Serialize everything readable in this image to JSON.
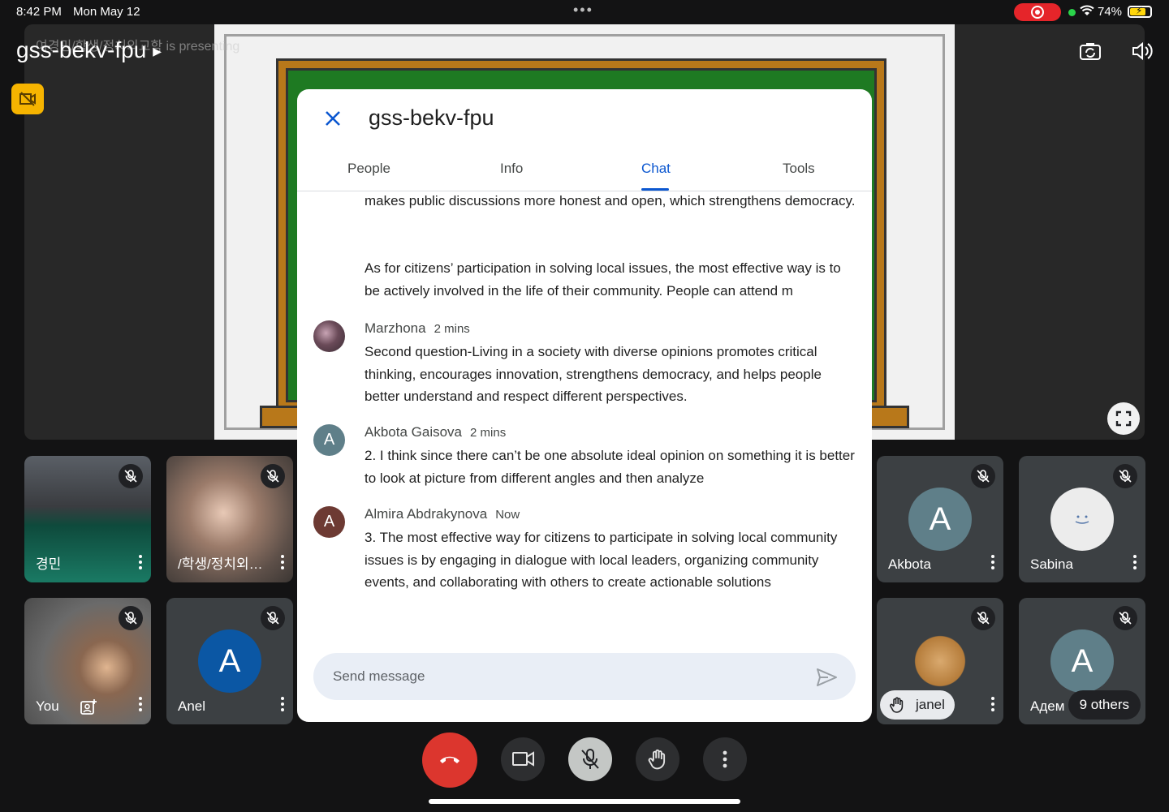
{
  "status_bar": {
    "time": "8:42 PM",
    "date": "Mon May 12",
    "battery": "74%",
    "battery_level": 0.74
  },
  "meeting": {
    "title": "gss-bekv-fpu",
    "presenting_text": "여경민/학생/정치외교학 is presenting"
  },
  "tiles": [
    {
      "name": "경민",
      "muted": true
    },
    {
      "name": "/학생/정치외…",
      "muted": true
    },
    {
      "name": "You",
      "muted": true
    },
    {
      "name": "Anel",
      "avatar_letter": "A",
      "avatar_color": "#0b57a4",
      "muted": true
    },
    {
      "name": "Akbota",
      "avatar_letter": "A",
      "avatar_color": "#5f7f89",
      "muted": true
    },
    {
      "name": "Sabina",
      "muted": true
    },
    {
      "name": "janel",
      "muted": true,
      "hand_raised": true
    },
    {
      "name": "Адем",
      "avatar_letter": "A",
      "avatar_color": "#5f7f89",
      "muted": true,
      "others_label": "9 others"
    }
  ],
  "dialog": {
    "title": "gss-bekv-fpu",
    "tabs": [
      "People",
      "Info",
      "Chat",
      "Tools"
    ],
    "active_tab": "Chat",
    "continued_message": {
      "paragraph1": "makes public discussions more honest and open, which strengthens democracy.",
      "paragraph2": "As for citizens’ participation in solving local issues, the most effective way is to be actively involved in the life of their community. People can attend m"
    },
    "messages": [
      {
        "sender": "Marzhona",
        "time": "2 mins",
        "avatar_letter": "",
        "avatar_color": "#7a5c68",
        "text": "Second question-Living in a society with diverse opinions promotes critical thinking, encourages innovation, strengthens democracy, and helps people better understand and respect different perspectives."
      },
      {
        "sender": "Akbota Gaisova",
        "time": "2 mins",
        "avatar_letter": "A",
        "avatar_color": "#5f7f89",
        "text": "2. I think since there can’t be one absolute ideal opinion on something it is better to look at picture from different angles and then analyze"
      },
      {
        "sender": "Almira Abdrakynova",
        "time": "Now",
        "avatar_letter": "A",
        "avatar_color": "#6d3a33",
        "text": "3. The most effective way for citizens to participate in solving local community issues is by engaging in dialogue with local leaders, organizing community events, and collaborating with others to create actionable solutions"
      }
    ],
    "composer_placeholder": "Send message"
  },
  "colors": {
    "accent": "#0b57d0",
    "end_call": "#dc362e",
    "camera_off_badge": "#f6b400",
    "recording": "#e5252a"
  },
  "icons": {
    "close": "close-icon",
    "send": "send-icon",
    "end_call": "phone-hangup-icon",
    "camera": "video-camera-icon",
    "mic": "mic-off-icon",
    "hand": "raise-hand-icon",
    "more": "more-vert-icon"
  }
}
